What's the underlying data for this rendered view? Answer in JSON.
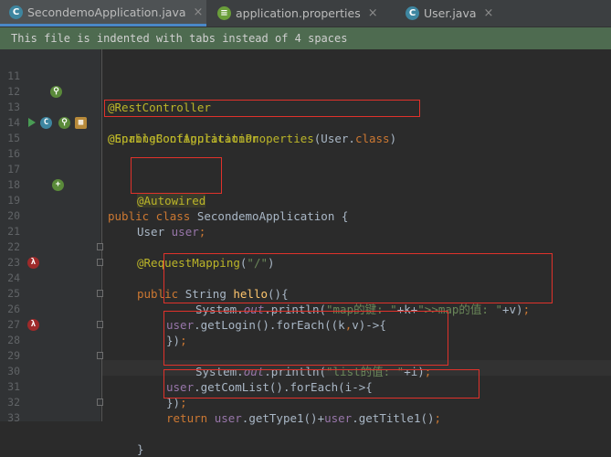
{
  "tabs": [
    {
      "label": "SecondemoApplication.java",
      "icon": "java-class-icon",
      "active": true
    },
    {
      "label": "application.properties",
      "icon": "properties-file-icon",
      "active": false
    },
    {
      "label": "User.java",
      "icon": "java-class-icon",
      "active": false
    }
  ],
  "banner": "This file is indented with tabs instead of 4 spaces",
  "line_numbers": [
    "11",
    "12",
    "13",
    "14",
    "15",
    "16",
    "17",
    "18",
    "19",
    "20",
    "21",
    "22",
    "23",
    "24",
    "25",
    "26",
    "27",
    "28",
    "29",
    "30",
    "31",
    "32",
    "33"
  ],
  "code": {
    "l12": "@RestController",
    "l13": "@SpringBootApplication",
    "l14_a": "@EnableConfigurationProperties",
    "l14_b": "(User.",
    "l14_c": "class",
    "l14_d": ")",
    "l15_a": "public class ",
    "l15_b": "SecondemoApplication {",
    "l18": "@Autowired",
    "l19_a": "User ",
    "l19_b": "user",
    "l19_c": ";",
    "l22_a": "@RequestMapping",
    "l22_b": "(",
    "l22_c": "\"/\"",
    "l22_d": ")",
    "l23_a": "public ",
    "l23_b": "String ",
    "l23_c": "hello",
    "l23_d": "(){",
    "l24_a": "user",
    "l24_b": ".getLogin().forEach((k",
    "l24_c": ",",
    "l24_d": "v)->{",
    "l25_a": "System.",
    "l25_b": "out",
    "l25_c": ".println(",
    "l25_d": "\"map的键: \"",
    "l25_e": "+k+",
    "l25_f": "\">>map的值: \"",
    "l25_g": "+v)",
    "l25_h": ";",
    "l26_a": "})",
    "l26_b": ";",
    "l28_a": "user",
    "l28_b": ".getComList().forEach(i->{",
    "l29_a": "System.",
    "l29_b": "out",
    "l29_c": ".println(",
    "l29_d": "\"list的值: \"",
    "l29_e": "+i)",
    "l29_f": ";",
    "l30_a": "})",
    "l30_b": ";",
    "l32_a": "return ",
    "l32_b": "user",
    "l32_c": ".getType1()+",
    "l32_d": "user",
    "l32_e": ".getTitle1()",
    "l32_f": ";",
    "l33": "}"
  },
  "colors": {
    "annotation": "#bbb529",
    "keyword": "#cc7832",
    "string": "#6a8759",
    "field": "#9876aa",
    "method": "#ffc66d",
    "highlight_box": "#e0322b"
  }
}
